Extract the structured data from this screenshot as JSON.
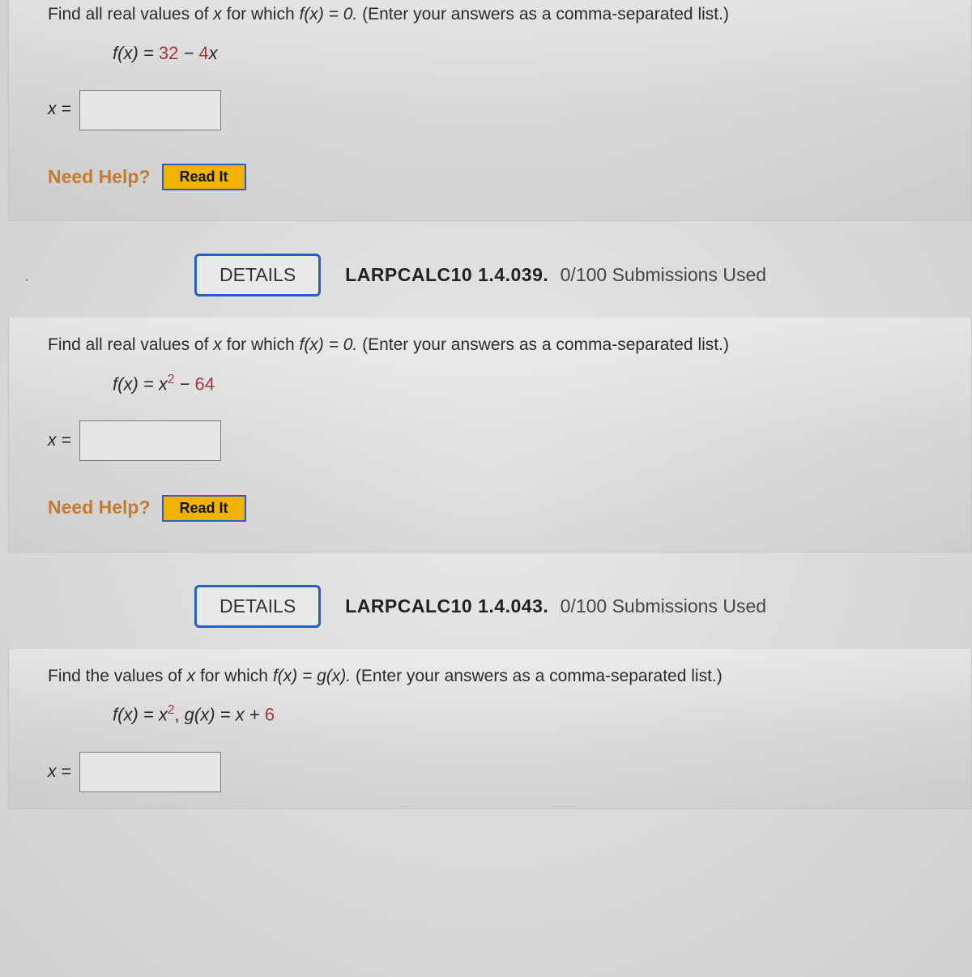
{
  "q1": {
    "prompt_a": "Find all real values of ",
    "prompt_var": "x",
    "prompt_b": " for which  ",
    "prompt_fx": "f(x) = 0.",
    "prompt_c": "  (Enter your answers as a comma-separated list.)",
    "eq_lhs": "f(x) = ",
    "eq_n1": "32",
    "eq_mid": " − ",
    "eq_n2": "4",
    "eq_tail": "x",
    "answer_label": "x =",
    "need_help": "Need Help?",
    "read_it": "Read It"
  },
  "h2": {
    "number": ".",
    "details": "DETAILS",
    "ref": "LARPCALC10 1.4.039.",
    "subs": "0/100 Submissions Used"
  },
  "q2": {
    "prompt_a": "Find all real values of ",
    "prompt_var": "x",
    "prompt_b": " for which  ",
    "prompt_fx": "f(x) = 0.",
    "prompt_c": "  (Enter your answers as a comma-separated list.)",
    "eq_lhs": "f(x) = x",
    "eq_sup": "2",
    "eq_mid": " − ",
    "eq_n1": "64",
    "answer_label": "x =",
    "need_help": "Need Help?",
    "read_it": "Read It"
  },
  "h3": {
    "details": "DETAILS",
    "ref": "LARPCALC10 1.4.043.",
    "subs": "0/100 Submissions Used"
  },
  "q3": {
    "prompt_a": "Find the values of ",
    "prompt_var": "x",
    "prompt_b": " for which  ",
    "prompt_fx": "f(x) = g(x).",
    "prompt_c": "  (Enter your answers as a comma-separated list.)",
    "eq_f_lhs": "f(x) = x",
    "eq_f_sup": "2",
    "eq_sep": ",    ",
    "eq_g_lhs": "g(x) = x + ",
    "eq_g_n": "6",
    "answer_label": "x ="
  }
}
